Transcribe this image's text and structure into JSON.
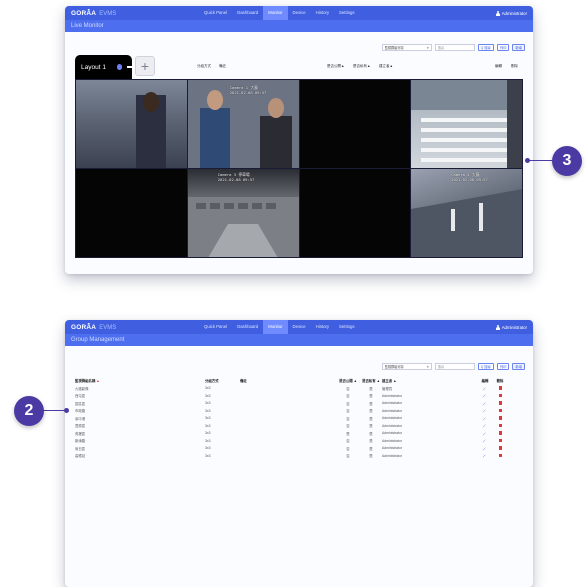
{
  "brand": {
    "name": "GORÂ̂A",
    "product": "EVMS"
  },
  "nav": [
    "Quick Panel",
    "Dashboard",
    "Monitor",
    "Device",
    "History",
    "Settings"
  ],
  "user": "Administrator",
  "screen1": {
    "title": "Live Monitor",
    "layout_tab": "Layout 1",
    "add_tab": "+",
    "select_value": "監視群組可存",
    "search_placeholder": "搜尋",
    "btn_search": "Q 搜尋",
    "btn_print": "列印",
    "btn_add": "新增",
    "col_headers": [
      "分組方式",
      "備註",
      "是否公開▲",
      "是否私有▲",
      "建立者▲",
      "編輯",
      "刪除"
    ],
    "cameras": [
      {
        "feed": "station",
        "label": "",
        "time": ""
      },
      {
        "feed": "station",
        "label": "Camera 1 大廳",
        "time": "2021-02-08 09:57"
      },
      {
        "feed": "black",
        "label": "",
        "time": ""
      },
      {
        "feed": "crossing",
        "label": "",
        "time": ""
      },
      {
        "feed": "black",
        "label": "",
        "time": ""
      },
      {
        "feed": "parking",
        "label": "Camera 3 停車場",
        "time": "2021-02-08 09:57"
      },
      {
        "feed": "black",
        "label": "",
        "time": ""
      },
      {
        "feed": "lobby",
        "label": "Camera 4 大廳",
        "time": "2021-02-08 09:57"
      }
    ],
    "callout": "3"
  },
  "screen2": {
    "title": "Group Management",
    "select_value": "監視群組可存",
    "search_placeholder": "搜尋",
    "btn_search": "Q 搜尋",
    "btn_print": "列印",
    "btn_add": "新增",
    "headers": {
      "name": "監視群組名稱",
      "sort": "▲",
      "type": "分組方式",
      "note": "備註",
      "a": "是否公開 ▲",
      "b": "是否私有 ▲",
      "creator": "建立者 ▲",
      "edit": "編輯",
      "del": "刪除"
    },
    "rows": [
      {
        "name": "九德影像",
        "type": "3x3",
        "a": "否",
        "b": "是",
        "creator": "管理員"
      },
      {
        "name": "西屯區",
        "type": "3x3",
        "a": "否",
        "b": "是",
        "creator": "Administrator"
      },
      {
        "name": "區區區",
        "type": "3x3",
        "a": "否",
        "b": "是",
        "creator": "Administrator"
      },
      {
        "name": "市政路",
        "type": "3x3",
        "a": "否",
        "b": "是",
        "creator": "Administrator"
      },
      {
        "name": "臺中港",
        "type": "3x3",
        "a": "否",
        "b": "是",
        "creator": "Administrator"
      },
      {
        "name": "豐原區",
        "type": "3x3",
        "a": "否",
        "b": "是",
        "creator": "Administrator"
      },
      {
        "name": "苑裡區",
        "type": "3x3",
        "a": "是",
        "b": "是",
        "creator": "Administrator"
      },
      {
        "name": "新湳路",
        "type": "3x3",
        "a": "否",
        "b": "是",
        "creator": "Administrator"
      },
      {
        "name": "烏日區",
        "type": "3x3",
        "a": "否",
        "b": "是",
        "creator": "Administrator"
      },
      {
        "name": "高鐵站",
        "type": "3x3",
        "a": "否",
        "b": "是",
        "creator": "Administrator"
      }
    ],
    "callout": "2"
  },
  "colors": {
    "accent": "#3f5fe0",
    "callout": "#4b3aa3",
    "delete": "#e03636"
  }
}
